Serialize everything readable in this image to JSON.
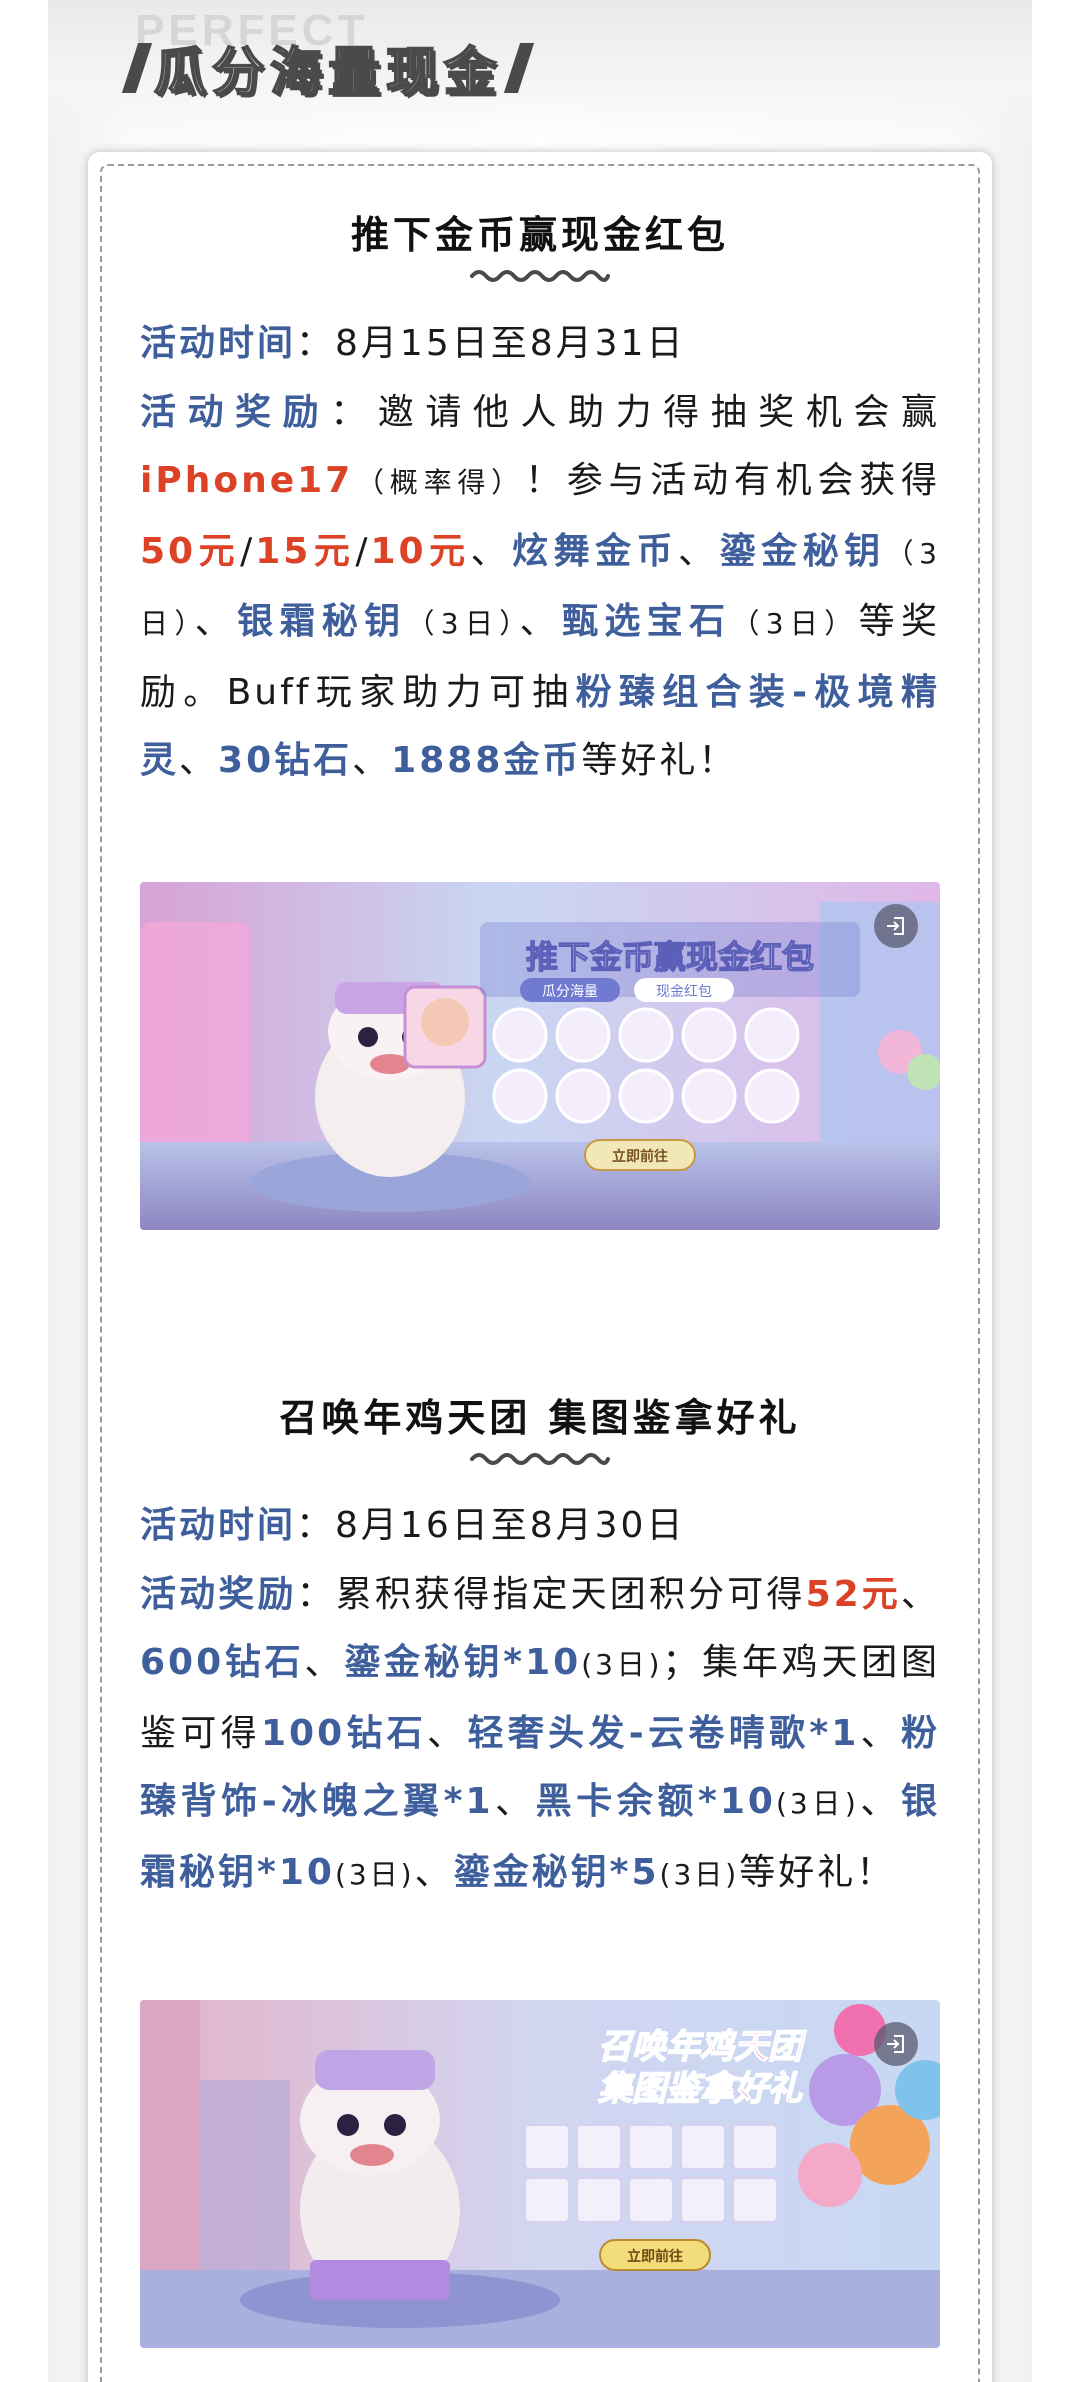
{
  "header": {
    "bg_text": "PERFECT",
    "title": "瓜分海量现金"
  },
  "section1": {
    "title": "推下金币赢现金红包",
    "time_label": "活动时间",
    "time_value": "：8月15日至8月31日",
    "reward_label": "活动奖励",
    "parts": [
      "：邀请他人助力得抽奖机会赢",
      "iPhone17",
      "（概率得）",
      "！参与活动有机会获得",
      "50元",
      "/",
      "15元",
      "/",
      "10元",
      "、",
      "炫舞金币",
      "、",
      "鎏金秘钥",
      "（3日）",
      "、",
      "银霜秘钥",
      "（3日）",
      "、",
      "甄选宝石",
      "（3日）",
      "等奖励。Buff玩家助力可抽",
      "粉臻组合装-极境精灵",
      "、",
      "30钻石",
      "、",
      "1888金币",
      "等好礼！"
    ],
    "banner": {
      "title": "推下金币赢现金红包",
      "subtitle_left": "瓜分海量",
      "subtitle_right": "现金红包",
      "button": "立即前往",
      "exit_icon": "exit-icon"
    }
  },
  "section2": {
    "title": "召唤年鸡天团 集图鉴拿好礼",
    "time_label": "活动时间",
    "time_value": "：8月16日至8月30日",
    "reward_label": "活动奖励",
    "parts": [
      "：累积获得指定天团积分可得",
      "52元",
      "、",
      "600钻石",
      "、",
      "鎏金秘钥*10",
      "(3日)",
      "；集年鸡天团图鉴可得",
      "100钻石",
      "、",
      "轻奢头发-云卷晴歌*1",
      "、",
      "粉臻背饰-冰魄之翼*1",
      "、",
      "黑卡余额*10",
      "(3日)",
      "、",
      "银霜秘钥*10",
      "(3日)",
      "、",
      "鎏金秘钥*5",
      "(3日)",
      "等好礼！"
    ],
    "banner": {
      "title_line1": "召唤年鸡天团",
      "title_line2": "集图鉴拿好礼",
      "button": "立即前往",
      "exit_icon": "exit-icon"
    }
  },
  "colors": {
    "label_blue": "#3e5e9c",
    "highlight_red": "#dc4226",
    "text": "#1a1a1a"
  }
}
